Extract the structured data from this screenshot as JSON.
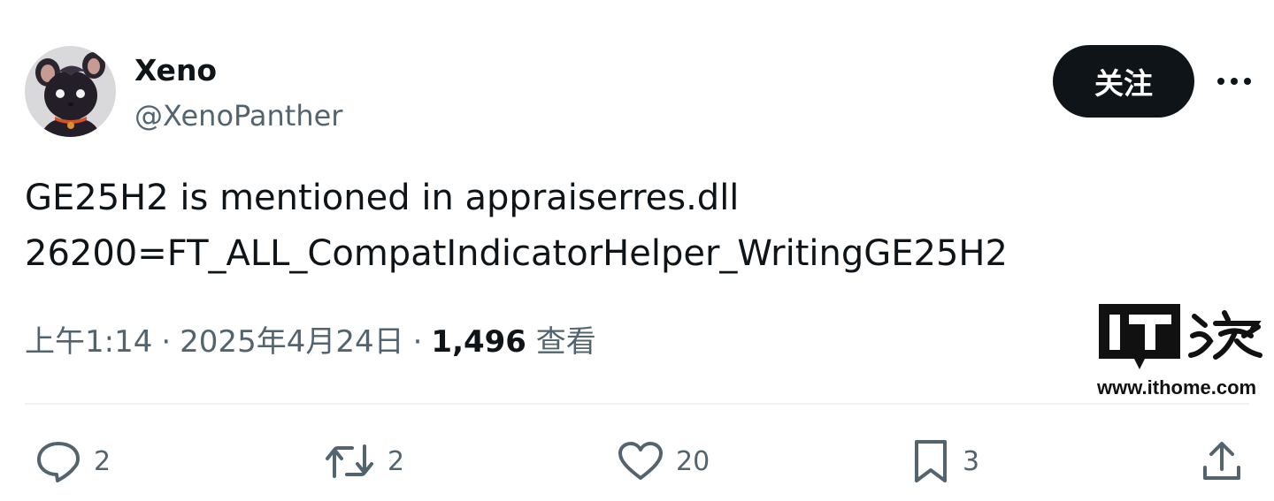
{
  "author": {
    "display_name": "Xeno",
    "handle": "@XenoPanther",
    "avatar_icon": "black-panther-furry-avatar"
  },
  "header_actions": {
    "follow_label": "关注",
    "more_icon": "more-horizontal-icon"
  },
  "tweet": {
    "lines": [
      "GE25H2 is mentioned in appraiserres.dll",
      "26200=FT_ALL_CompatIndicatorHelper_WritingGE25H2"
    ]
  },
  "meta": {
    "time": "上午1:14",
    "separator": "·",
    "date": "2025年4月24日",
    "views_count": "1,496",
    "views_label": "查看"
  },
  "watermark": {
    "logo_text": "IT之家",
    "url": "www.ithome.com"
  },
  "actions": {
    "reply": {
      "icon": "reply-icon",
      "count": "2"
    },
    "retweet": {
      "icon": "retweet-icon",
      "count": "2"
    },
    "like": {
      "icon": "heart-icon",
      "count": "20"
    },
    "bookmark": {
      "icon": "bookmark-icon",
      "count": "3"
    },
    "share": {
      "icon": "share-icon"
    }
  },
  "colors": {
    "primary_text": "#0f1419",
    "secondary_text": "#536471",
    "divider": "#eff3f4",
    "follow_bg": "#0f1419"
  }
}
